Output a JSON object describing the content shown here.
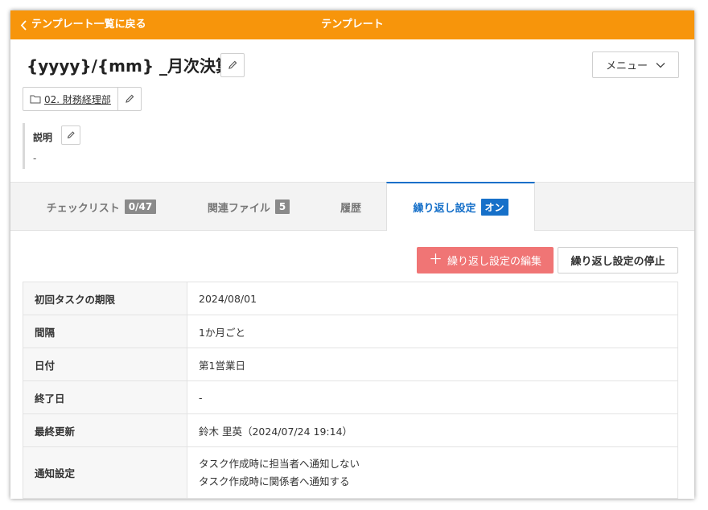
{
  "topbar": {
    "back_label": "テンプレート一覧に戻る",
    "title": "テンプレート",
    "color": "#f7950b"
  },
  "template": {
    "title": "{yyyy}/{mm} _月次決算",
    "folder": "02. 財務経理部",
    "description_label": "説明",
    "description_value": "-"
  },
  "menu": {
    "label": "メニュー"
  },
  "tabs": [
    {
      "label": "チェックリスト",
      "badge": "0/47",
      "active": false
    },
    {
      "label": "関連ファイル",
      "badge": "5",
      "active": false
    },
    {
      "label": "履歴",
      "badge": "",
      "active": false
    },
    {
      "label": "繰り返し設定",
      "badge": "オン",
      "active": true
    }
  ],
  "actions": {
    "edit_label": "繰り返し設定の編集",
    "stop_label": "繰り返し設定の停止"
  },
  "settings": [
    {
      "key": "初回タスクの期限",
      "value": "2024/08/01"
    },
    {
      "key": "間隔",
      "value": "1か月ごと"
    },
    {
      "key": "日付",
      "value": "第1営業日"
    },
    {
      "key": "終了日",
      "value": "-"
    },
    {
      "key": "最終更新",
      "value": "鈴木 里英（2024/07/24 19:14）"
    },
    {
      "key": "通知設定",
      "lines": [
        "タスク作成時に担当者へ通知しない",
        "タスク作成時に関係者へ通知する"
      ]
    }
  ],
  "colors": {
    "accent_orange": "#f7950b",
    "active_tab_blue": "#1670c9",
    "edit_button": "#f07575"
  }
}
